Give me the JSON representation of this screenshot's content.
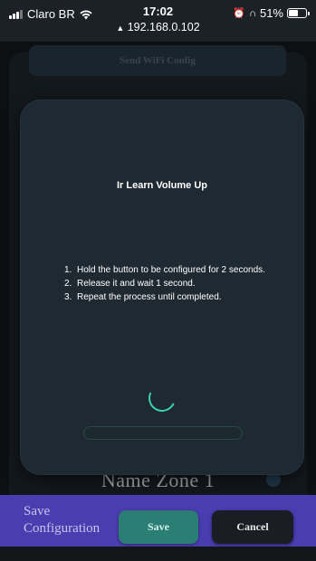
{
  "status_bar": {
    "carrier": "Claro BR",
    "time": "17:02",
    "url": "192.168.0.102",
    "battery": "51%"
  },
  "background": {
    "send_wifi_label": "Send WiFi Config",
    "zone_name": "Name Zone 1"
  },
  "modal": {
    "title": "Ir Learn Volume Up",
    "steps": [
      {
        "num": "1.",
        "text": "Hold the button to be configured for 2 seconds."
      },
      {
        "num": "2.",
        "text": "Release it and wait 1 second."
      },
      {
        "num": "3.",
        "text": "Repeat the process until completed."
      }
    ],
    "progress": 0
  },
  "footer": {
    "label_line1": "Save",
    "label_line2": "Configuration",
    "save_label": "Save",
    "cancel_label": "Cancel"
  },
  "colors": {
    "accent": "#3ed1b4",
    "save_button": "#2a7e74",
    "footer_bg": "#4a3db0"
  }
}
